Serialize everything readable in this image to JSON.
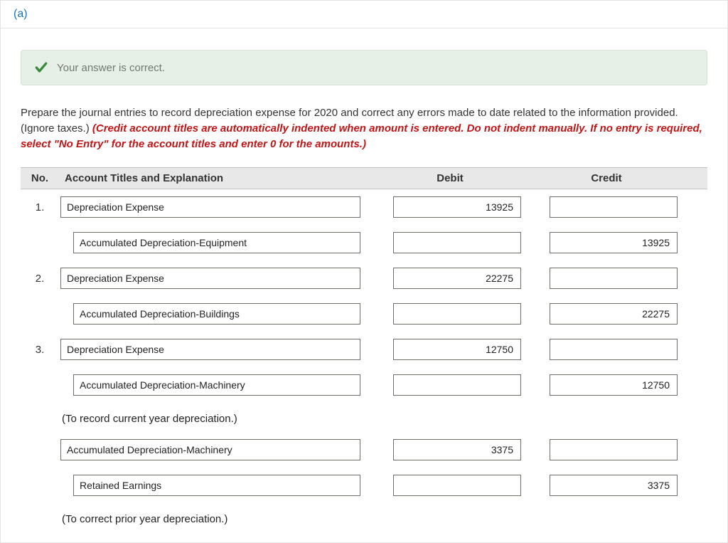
{
  "part_label": "(a)",
  "alert": {
    "message": "Your answer is correct."
  },
  "instructions": {
    "text_before": "Prepare the journal entries to record depreciation expense for 2020 and correct any errors made to date related to the information provided. (Ignore taxes.) ",
    "text_red": "(Credit account titles are automatically indented when amount is entered. Do not indent manually. If no entry is required, select \"No Entry\" for the account titles and enter 0 for the amounts.)"
  },
  "columns": {
    "no": "No.",
    "account": "Account Titles and Explanation",
    "debit": "Debit",
    "credit": "Credit"
  },
  "rows": [
    {
      "no": "1.",
      "account": "Depreciation Expense",
      "indent": false,
      "debit": "13925",
      "credit": "",
      "caption": ""
    },
    {
      "no": "",
      "account": "Accumulated Depreciation-Equipment",
      "indent": true,
      "debit": "",
      "credit": "13925",
      "caption": ""
    },
    {
      "no": "2.",
      "account": "Depreciation Expense",
      "indent": false,
      "debit": "22275",
      "credit": "",
      "caption": ""
    },
    {
      "no": "",
      "account": "Accumulated Depreciation-Buildings",
      "indent": true,
      "debit": "",
      "credit": "22275",
      "caption": ""
    },
    {
      "no": "3.",
      "account": "Depreciation Expense",
      "indent": false,
      "debit": "12750",
      "credit": "",
      "caption": ""
    },
    {
      "no": "",
      "account": "Accumulated Depreciation-Machinery",
      "indent": true,
      "debit": "",
      "credit": "12750",
      "caption": "(To record current year depreciation.)"
    },
    {
      "no": "",
      "account": "Accumulated Depreciation-Machinery",
      "indent": false,
      "debit": "3375",
      "credit": "",
      "caption": ""
    },
    {
      "no": "",
      "account": "Retained Earnings",
      "indent": true,
      "debit": "",
      "credit": "3375",
      "caption": "(To correct prior year depreciation.)"
    }
  ]
}
